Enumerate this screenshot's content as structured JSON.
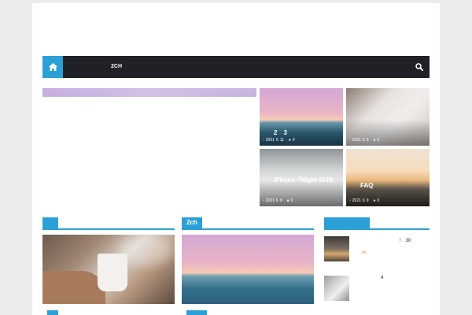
{
  "nav": {
    "item": "2CH"
  },
  "featured": [
    {
      "title": "2　3",
      "year": "2021",
      "month": "6",
      "day": "11",
      "comments": "0"
    },
    {
      "title": "",
      "year": "2021",
      "month": "6",
      "day": "9",
      "comments": "0"
    },
    {
      "title": "iPhone「Night Shift",
      "year": "2021",
      "month": "6",
      "day": "9",
      "comments": "0"
    },
    {
      "title": "FAQ",
      "year": "2021",
      "month": "6",
      "day": "9",
      "comments": "0"
    }
  ],
  "sections": {
    "left": {
      "label": ""
    },
    "middle": {
      "label": "2ch"
    },
    "right": {
      "label": ""
    }
  },
  "sidebar": {
    "item1": {
      "text": "!　30",
      "meta": ".on"
    },
    "item2": {
      "text": "4",
      "meta": ""
    }
  },
  "colors": {
    "accent": "#2ba0d6",
    "navbar": "#1f2126",
    "highlight": "#e67e22"
  }
}
